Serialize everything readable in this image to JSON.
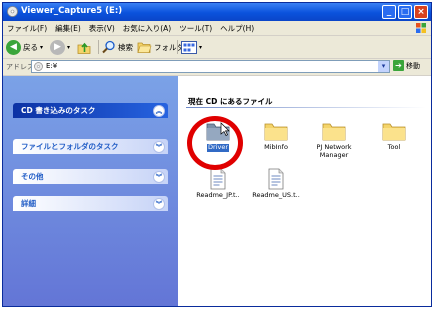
{
  "window": {
    "title": "Viewer_Capture5 (E:)"
  },
  "menu": [
    "ファイル(F)",
    "編集(E)",
    "表示(V)",
    "お気に入り(A)",
    "ツール(T)",
    "ヘルプ(H)"
  ],
  "toolbar": {
    "back": "戻る",
    "search": "検索",
    "folders": "フォルダ"
  },
  "address": {
    "label": "アドレス(D)",
    "value": "E:¥",
    "go": "移動"
  },
  "left_tasks": [
    {
      "label": "CD 書き込みのタスク"
    },
    {
      "label": "ファイルとフォルダのタスク"
    },
    {
      "label": "その他"
    },
    {
      "label": "詳細"
    }
  ],
  "section": {
    "heading": "現在 CD にあるファイル"
  },
  "files": [
    {
      "name": "Driver",
      "type": "folder",
      "selected": true
    },
    {
      "name": "MibInfo",
      "type": "folder"
    },
    {
      "name": "PJ Network Manager",
      "type": "folder"
    },
    {
      "name": "Tool",
      "type": "folder"
    },
    {
      "name": "Readme_JP.t..",
      "type": "text"
    },
    {
      "name": "Readme_US.t..",
      "type": "text"
    }
  ],
  "colors": {
    "titlebar": "#0a52dc",
    "selection": "#316ac5",
    "highlight_circle": "#e00000"
  }
}
